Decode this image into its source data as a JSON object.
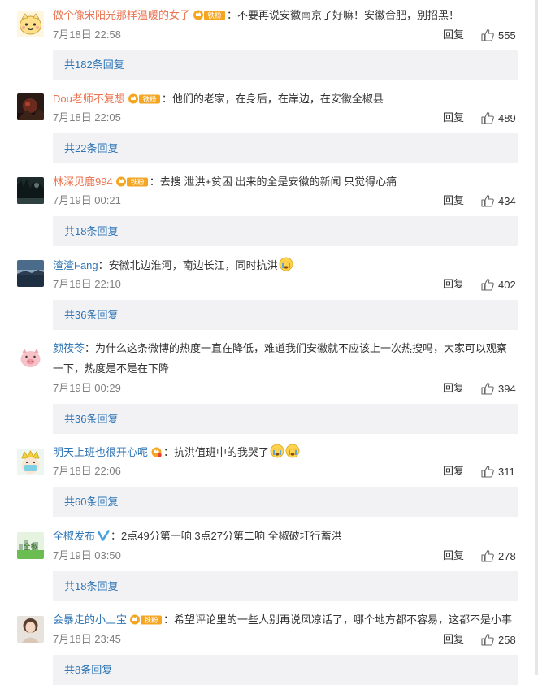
{
  "ui": {
    "reply_label": "回复",
    "fan_badge_label": "铁粉",
    "colors": {
      "username_orange": "#eb7350",
      "link_blue": "#2f75b5",
      "reply_box_bg": "#f2f2f5",
      "meta_gray": "#808080"
    }
  },
  "comments": [
    {
      "username": "做个像宋阳光那样温暖的女子",
      "badge": "铁粉",
      "text": "：不要再说安徽南京了好嘛！安徽合肥，别招黑！",
      "time": "7月18日 22:58",
      "likes": "555",
      "replies": "共182条回复",
      "avatar_icon": "cartoon-face-avatar"
    },
    {
      "username": "Dou老师不复想",
      "badge": "铁粉",
      "text": "：他们的老家，在身后，在岸边，在安徽全椒县",
      "time": "7月18日 22:05",
      "likes": "489",
      "replies": "共22条回复",
      "avatar_icon": "dark-photo-avatar"
    },
    {
      "username": "林深见鹿994",
      "badge": "铁粉",
      "text": "：去搜 泄洪+贫困 出来的全是安徽的新闻 只觉得心痛",
      "time": "7月19日 00:21",
      "likes": "434",
      "replies": "共18条回复",
      "avatar_icon": "forest-photo-avatar"
    },
    {
      "username": "渣渣Fang",
      "text": "：安徽北边淮河，南边长江，同时抗洪",
      "emoji_count": 1,
      "time": "7月18日 22:10",
      "likes": "402",
      "replies": "共36条回复",
      "avatar_icon": "landscape-photo-avatar"
    },
    {
      "username": "颜筱苓",
      "text": "：为什么这条微博的热度一直在降低，难道我们安徽就不应该上一次热搜吗，大家可以观察一下，热度是不是在下降",
      "time": "7月19日 00:29",
      "likes": "394",
      "replies": "共36条回复",
      "avatar_icon": "pig-avatar"
    },
    {
      "username": "明天上班也很开心呢",
      "badge_icon_only": true,
      "text": "：抗洪值班中的我哭了",
      "emoji_count": 2,
      "time": "7月18日 22:06",
      "likes": "311",
      "replies": "共60条回复",
      "avatar_icon": "crown-mask-avatar"
    },
    {
      "username": "全椒发布",
      "verified": true,
      "text": "：2点49分第一响 3点27分第二响 全椒破圩行蓄洪",
      "time": "7月19日 03:50",
      "likes": "278",
      "replies": "共18条回复",
      "avatar_icon": "city-logo-avatar",
      "avatar_text": "全椒"
    },
    {
      "username": "会暴走的小土宝",
      "badge": "铁粉",
      "text": "：希望评论里的一些人别再说风凉话了，哪个地方都不容易，这都不是小事",
      "time": "7月18日 23:45",
      "likes": "258",
      "replies": "共8条回复",
      "avatar_icon": "girl-photo-avatar"
    }
  ]
}
